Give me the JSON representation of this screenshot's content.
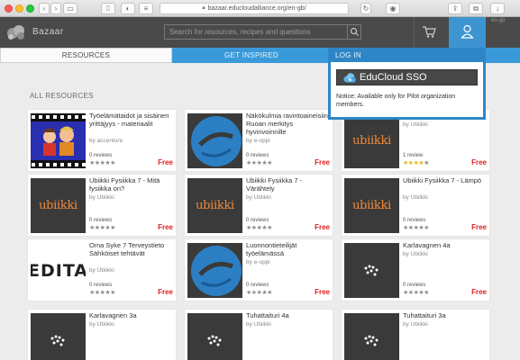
{
  "browser": {
    "url": "bazaar.educloudalliance.org/en-gb/"
  },
  "header": {
    "brand": "Bazaar",
    "search_placeholder": "Search for resources, recipes and questions",
    "language": "en-gb"
  },
  "tabs": {
    "resources": "RESOURCES",
    "inspired": "GET INSPIRED"
  },
  "section_title": "ALL RESOURCES",
  "login_popup": {
    "title": "LOG IN",
    "sso_label": "EduCloud SSO",
    "notice": "Notice: Available only for Pilot organization members."
  },
  "cards": [
    {
      "title": "Työelämätaidot ja sisäinen yrittäjyys - materiaalit",
      "by": "by accenture",
      "reviews": "0 reviews",
      "rating": 0,
      "price": "Free",
      "thumb": "film",
      "thumb_text": ""
    },
    {
      "title": "Näkökulmia ravintoaineisiin: Ruoan merkitys hyvinvoinnille",
      "by": "by e-oppi",
      "reviews": "0 reviews",
      "rating": 0,
      "price": "Free",
      "thumb": "eoppi",
      "thumb_text": ""
    },
    {
      "title": "Avaruus",
      "by": "by Ubiikki",
      "reviews": "1 review",
      "rating": 4,
      "price": "Free",
      "thumb": "ubiikki",
      "thumb_text": "ubiikki"
    },
    {
      "title": "Ubiikki Fysiikka 7 - Mitä fysiikka on?",
      "by": "by Ubiikki",
      "reviews": "0 reviews",
      "rating": 0,
      "price": "Free",
      "thumb": "ubiikki",
      "thumb_text": "ubiikki"
    },
    {
      "title": "Ubiikki Fysiikka 7 - Värähtely",
      "by": "by Ubiikki",
      "reviews": "0 reviews",
      "rating": 0,
      "price": "Free",
      "thumb": "ubiikki",
      "thumb_text": "ubiikki"
    },
    {
      "title": "Ubiikki Fysiikka 7 - Lämpö",
      "by": "by Ubiikki",
      "reviews": "0 reviews",
      "rating": 0,
      "price": "Free",
      "thumb": "ubiikki",
      "thumb_text": "ubiikki"
    },
    {
      "title": "Oma Syke 7 Terveystieto Sähköiset tehtävät",
      "by": "by Ubiikki",
      "reviews": "0 reviews",
      "rating": 0,
      "price": "Free",
      "thumb": "edita",
      "thumb_text": "EDITA"
    },
    {
      "title": "Luonnontieteilijät työelämässä",
      "by": "by e-oppi",
      "reviews": "0 reviews",
      "rating": 0,
      "price": "Free",
      "thumb": "eoppi",
      "thumb_text": ""
    },
    {
      "title": "Karlavagnen 4a",
      "by": "by Ubiikki",
      "reviews": "0 reviews",
      "rating": 0,
      "price": "Free",
      "thumb": "dots",
      "thumb_text": ""
    },
    {
      "title": "Karlavagnen 3a",
      "by": "by Ubiikki",
      "reviews": "",
      "rating": 0,
      "price": "",
      "thumb": "dots",
      "thumb_text": ""
    },
    {
      "title": "Tuhattaituri 4a",
      "by": "by Ubiikki",
      "reviews": "",
      "rating": 0,
      "price": "",
      "thumb": "dots",
      "thumb_text": ""
    },
    {
      "title": "Tuhattaituri 3a",
      "by": "by Ubiikki",
      "reviews": "",
      "rating": 0,
      "price": "",
      "thumb": "dots",
      "thumb_text": ""
    }
  ],
  "colors": {
    "header_bg": "#4a4a4a",
    "accent_blue": "#3a9ad9",
    "price_red": "#e02020",
    "star_gold": "#e5b81f"
  }
}
